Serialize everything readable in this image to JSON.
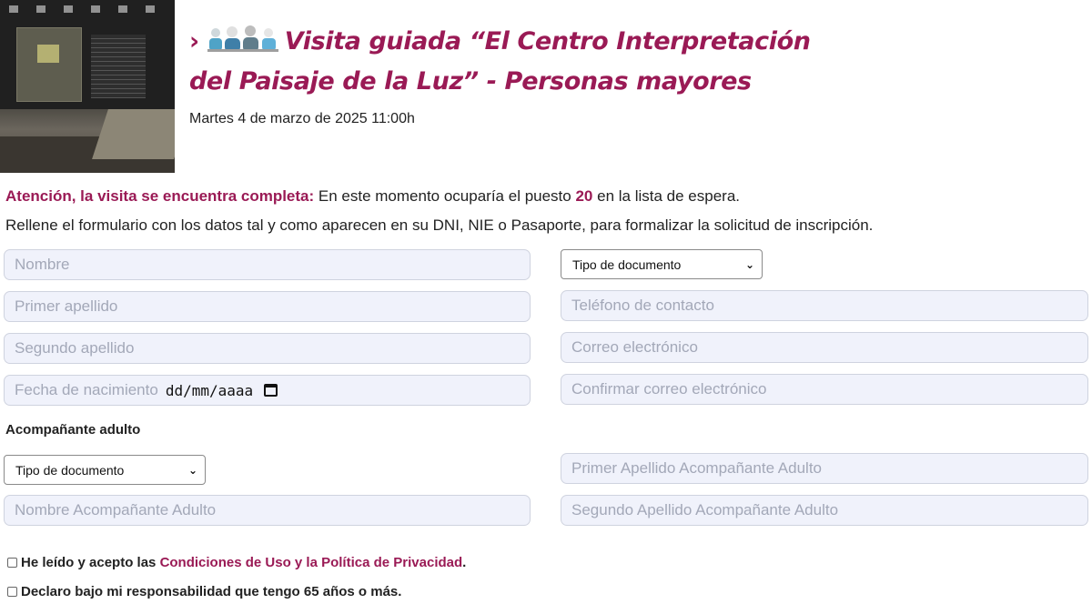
{
  "event": {
    "title_line1": "Visita guiada “El Centro Interpretación",
    "title_line2": "del Paisaje de la Luz” - Personas mayores",
    "date": "Martes 4 de marzo de 2025 11:00h"
  },
  "notice": {
    "lead": "Atención, la visita se encuentra completa:",
    "text_before": " En este momento ocuparía el puesto ",
    "position": "20",
    "text_after": " en la lista de espera."
  },
  "instructions": "Rellene el formulario con los datos tal y como aparecen en su DNI, NIE o Pasaporte, para formalizar la solicitud de inscripción.",
  "form": {
    "nombre_placeholder": "Nombre",
    "tipo_documento": "Tipo de documento",
    "primer_apellido_placeholder": "Primer apellido",
    "telefono_placeholder": "Teléfono de contacto",
    "segundo_apellido_placeholder": "Segundo apellido",
    "correo_placeholder": "Correo electrónico",
    "fecha_label": "Fecha de nacimiento",
    "fecha_value": "dd/mm/aaaa",
    "confirmar_correo_placeholder": "Confirmar correo electrónico"
  },
  "companion": {
    "section_label": "Acompañante adulto",
    "tipo_documento": "Tipo de documento",
    "primer_apellido_placeholder": "Primer Apellido Acompañante Adulto",
    "nombre_placeholder": "Nombre Acompañante Adulto",
    "segundo_apellido_placeholder": "Segundo Apellido Acompañante Adulto"
  },
  "consent": {
    "terms_prefix": "He leído y acepto las ",
    "terms_link": "Condiciones de Uso y la Política de Privacidad",
    "terms_suffix": ".",
    "age_declaration": "Declaro bajo mi responsabilidad que tengo 65 años o más."
  },
  "icons": {
    "chevron": "chevron-right-icon",
    "seniors": "seniors-group-icon",
    "calendar": "calendar-icon",
    "dropdown": "chevron-down-icon"
  },
  "colors": {
    "accent": "#9a1a55",
    "field_bg": "#f0f2fb",
    "field_border": "#cfd3df",
    "placeholder": "#a3a8b8"
  }
}
